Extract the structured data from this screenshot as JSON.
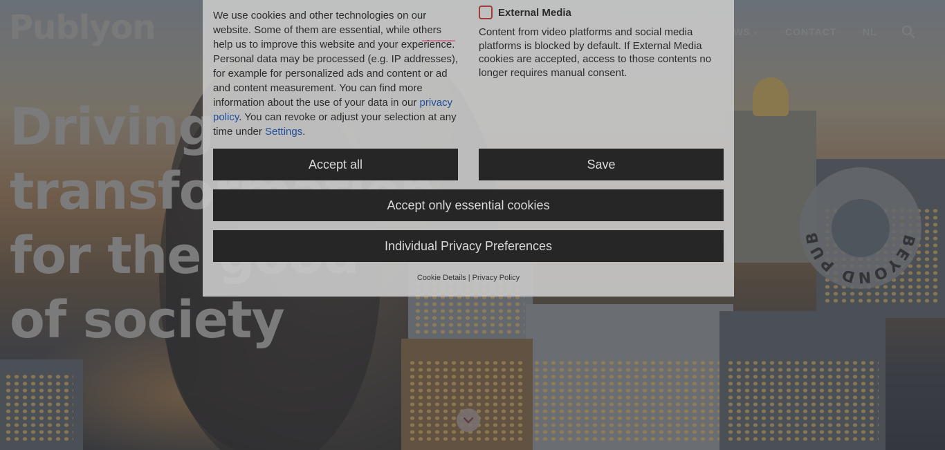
{
  "header": {
    "logo": "Publyon",
    "nav": [
      {
        "label": "NEWS",
        "has_dropdown": true
      },
      {
        "label": "CONTACT"
      },
      {
        "label": "NL"
      }
    ],
    "search_icon": "search-icon"
  },
  "hero": {
    "headline_lines": [
      "Driving",
      "transformation",
      "for the good",
      "of society"
    ],
    "badge_text": "BEYOND PUBLIC AFFAIRS",
    "scroll_icon": "chevron-down-icon"
  },
  "cookie_dialog": {
    "intro_cut": "",
    "body_text_1": "We use cookies and other technologies on our website. Some of them are essential, while others help us to improve this website and your experience. Personal data may be processed (e.g. IP addresses), for example for personalized ads and content or ad and content measurement. You can find more information about the use of your data in our ",
    "privacy_link": "privacy policy",
    "body_text_2": ". You can revoke or adjust your selection at any time under ",
    "settings_link": "Settings",
    "body_text_3": ".",
    "external_media": {
      "label": "External Media",
      "checked": false,
      "description": "Content from video platforms and social media platforms is blocked by default. If External Media cookies are accepted, access to those contents no longer requires manual consent."
    },
    "buttons": {
      "accept_all": "Accept all",
      "save": "Save",
      "accept_essential": "Accept only essential cookies",
      "individual": "Individual Privacy Preferences"
    },
    "footer": {
      "cookie_details": "Cookie Details",
      "separator": "|",
      "privacy_policy": "Privacy Policy"
    }
  },
  "colors": {
    "overlay": "#3a3a3a",
    "dialog_bg": "#c6c6c6",
    "button_bg": "#262626",
    "link": "#1e4f9c",
    "checkbox_border": "#a23a3a"
  }
}
